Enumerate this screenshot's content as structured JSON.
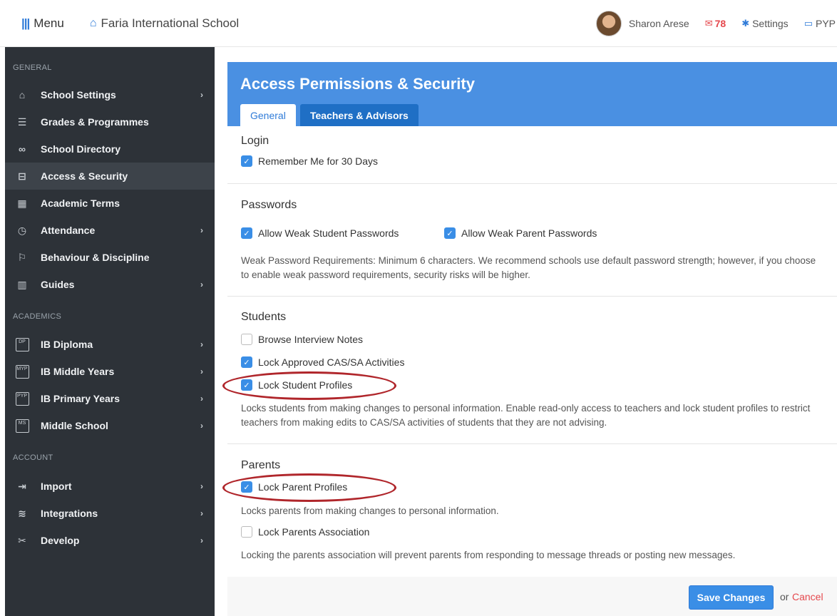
{
  "topbar": {
    "menu_label": "Menu",
    "school_name": "Faria International School",
    "user_name": "Sharon Arese",
    "mail_count": "78",
    "settings_label": "Settings",
    "programme_label": "PYP"
  },
  "sidebar": {
    "sections": {
      "general": "GENERAL",
      "academics": "ACADEMICS",
      "account": "ACCOUNT"
    },
    "items": [
      {
        "label": "School Settings",
        "icon": "bank-icon",
        "chevron": true
      },
      {
        "label": "Grades & Programmes",
        "icon": "list-icon",
        "chevron": false
      },
      {
        "label": "School Directory",
        "icon": "users-icon",
        "chevron": false
      },
      {
        "label": "Access & Security",
        "icon": "lock-icon",
        "chevron": false,
        "active": true
      },
      {
        "label": "Academic Terms",
        "icon": "calendar-icon",
        "chevron": false
      },
      {
        "label": "Attendance",
        "icon": "calendar-clock-icon",
        "chevron": true
      },
      {
        "label": "Behaviour & Discipline",
        "icon": "flag-icon",
        "chevron": false
      },
      {
        "label": "Guides",
        "icon": "map-icon",
        "chevron": true
      },
      {
        "label": "IB Diploma",
        "icon": "dp-icon",
        "badge": "DP",
        "chevron": true
      },
      {
        "label": "IB Middle Years",
        "icon": "myp-icon",
        "badge": "MYP",
        "chevron": true
      },
      {
        "label": "IB Primary Years",
        "icon": "pyp-icon",
        "badge": "PYP",
        "chevron": true
      },
      {
        "label": "Middle School",
        "icon": "ms-icon",
        "badge": "MS",
        "chevron": true
      },
      {
        "label": "Import",
        "icon": "import-icon",
        "chevron": true
      },
      {
        "label": "Integrations",
        "icon": "layers-icon",
        "chevron": true
      },
      {
        "label": "Develop",
        "icon": "tools-icon",
        "chevron": true
      }
    ]
  },
  "panel": {
    "title": "Access Permissions & Security",
    "tabs": [
      {
        "label": "General",
        "active": true
      },
      {
        "label": "Teachers & Advisors",
        "active": false
      }
    ]
  },
  "sections": {
    "login": {
      "title": "Login",
      "remember_me": {
        "label": "Remember Me for 30 Days",
        "checked": true
      }
    },
    "passwords": {
      "title": "Passwords",
      "weak_student": {
        "label": "Allow Weak Student Passwords",
        "checked": true
      },
      "weak_parent": {
        "label": "Allow Weak Parent Passwords",
        "checked": true
      },
      "help": "Weak Password Requirements: Minimum 6 characters. We recommend schools use default password strength; however, if you choose to enable weak password requirements, security risks will be higher."
    },
    "students": {
      "title": "Students",
      "browse_notes": {
        "label": "Browse Interview Notes",
        "checked": false
      },
      "lock_cas": {
        "label": "Lock Approved CAS/SA Activities",
        "checked": true
      },
      "lock_profiles": {
        "label": "Lock Student Profiles",
        "checked": true
      },
      "help": "Locks students from making changes to personal information. Enable read-only access to teachers and lock student profiles to restrict teachers from making edits to CAS/SA activities of students that they are not advising."
    },
    "parents": {
      "title": "Parents",
      "lock_profiles": {
        "label": "Lock Parent Profiles",
        "checked": true
      },
      "lock_profiles_help": "Locks parents from making changes to personal information.",
      "lock_association": {
        "label": "Lock Parents Association",
        "checked": false
      },
      "lock_association_help": "Locking the parents association will prevent parents from responding to message threads or posting new messages."
    }
  },
  "footer": {
    "save_label": "Save Changes",
    "or_label": "or",
    "cancel_label": "Cancel"
  },
  "colors": {
    "accent": "#4a90e2",
    "sidebar_bg": "#2d3238",
    "annotation": "#b0262b",
    "danger": "#e5484d"
  }
}
